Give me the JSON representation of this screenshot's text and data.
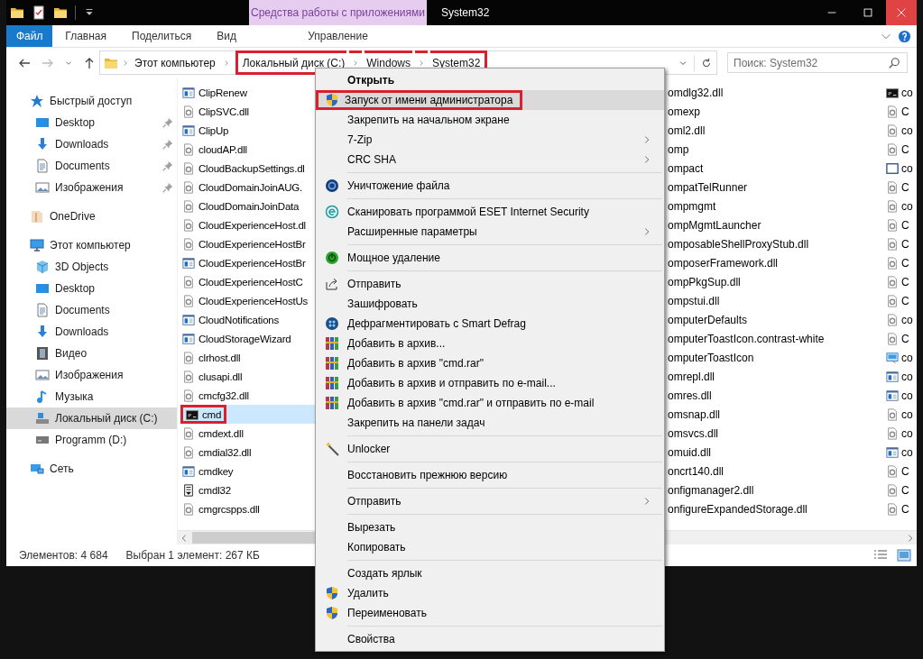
{
  "window": {
    "title": "System32",
    "context_tab": "Средства работы с приложениями"
  },
  "ribbon": {
    "tabs": [
      {
        "label": "Файл",
        "kind": "file",
        "selected": false
      },
      {
        "label": "Главная",
        "kind": "plain",
        "selected": false
      },
      {
        "label": "Поделиться",
        "kind": "plain",
        "selected": false
      },
      {
        "label": "Вид",
        "kind": "plain",
        "selected": false
      },
      {
        "label": "Управление",
        "kind": "context",
        "selected": false
      }
    ]
  },
  "address_bar": {
    "crumbs": [
      {
        "label": "Этот компьютер",
        "highlighted": false
      },
      {
        "label": "Локальный диск (C:)",
        "highlighted": true
      },
      {
        "label": "Windows",
        "highlighted": true
      },
      {
        "label": "System32",
        "highlighted": true
      }
    ]
  },
  "search": {
    "placeholder": "Поиск: System32"
  },
  "navigation": {
    "items": [
      {
        "label": "Быстрый доступ",
        "kind": "star",
        "selected": false,
        "children": [
          {
            "label": "Desktop",
            "kind": "desktop",
            "pinned": true,
            "selected": false
          },
          {
            "label": "Downloads",
            "kind": "download",
            "pinned": true,
            "selected": false
          },
          {
            "label": "Documents",
            "kind": "document",
            "pinned": true,
            "selected": false
          },
          {
            "label": "Изображения",
            "kind": "pictures",
            "pinned": true,
            "selected": false
          }
        ]
      },
      {
        "label": "OneDrive",
        "kind": "cloud_folder",
        "selected": false
      },
      {
        "label": "Этот компьютер",
        "kind": "computer",
        "selected": false,
        "children": [
          {
            "label": "3D Objects",
            "kind": "cube",
            "selected": false
          },
          {
            "label": "Desktop",
            "kind": "desktop",
            "selected": false
          },
          {
            "label": "Documents",
            "kind": "document",
            "selected": false
          },
          {
            "label": "Downloads",
            "kind": "download",
            "selected": false
          },
          {
            "label": "Видео",
            "kind": "video",
            "selected": false
          },
          {
            "label": "Изображения",
            "kind": "pictures",
            "selected": false
          },
          {
            "label": "Музыка",
            "kind": "music",
            "selected": false
          },
          {
            "label": "Локальный диск (C:)",
            "kind": "system_drive",
            "selected": true
          },
          {
            "label": "Programm (D:)",
            "kind": "drive",
            "selected": false
          }
        ]
      },
      {
        "label": "Сеть",
        "kind": "network",
        "selected": false
      }
    ]
  },
  "files": {
    "columns": [
      {
        "items": [
          {
            "name": "ClipRenew",
            "kind": "app",
            "selected": false,
            "highlighted": false
          },
          {
            "name": "ClipSVC.dll",
            "kind": "dll",
            "selected": false,
            "highlighted": false
          },
          {
            "name": "ClipUp",
            "kind": "app",
            "selected": false,
            "highlighted": false
          },
          {
            "name": "cloudAP.dll",
            "kind": "dll",
            "selected": false,
            "highlighted": false
          },
          {
            "name": "CloudBackupSettings.dl",
            "kind": "dll",
            "selected": false,
            "highlighted": false
          },
          {
            "name": "CloudDomainJoinAUG.",
            "kind": "dll",
            "selected": false,
            "highlighted": false
          },
          {
            "name": "CloudDomainJoinData",
            "kind": "dll",
            "selected": false,
            "highlighted": false
          },
          {
            "name": "CloudExperienceHost.dl",
            "kind": "dll",
            "selected": false,
            "highlighted": false
          },
          {
            "name": "CloudExperienceHostBr",
            "kind": "dll",
            "selected": false,
            "highlighted": false
          },
          {
            "name": "CloudExperienceHostBr",
            "kind": "app",
            "selected": false,
            "highlighted": false
          },
          {
            "name": "CloudExperienceHostC",
            "kind": "dll",
            "selected": false,
            "highlighted": false
          },
          {
            "name": "CloudExperienceHostUs",
            "kind": "dll",
            "selected": false,
            "highlighted": false
          },
          {
            "name": "CloudNotifications",
            "kind": "app",
            "selected": false,
            "highlighted": false
          },
          {
            "name": "CloudStorageWizard",
            "kind": "app",
            "selected": false,
            "highlighted": false
          },
          {
            "name": "clrhost.dll",
            "kind": "dll",
            "selected": false,
            "highlighted": false
          },
          {
            "name": "clusapi.dll",
            "kind": "dll",
            "selected": false,
            "highlighted": false
          },
          {
            "name": "cmcfg32.dll",
            "kind": "dll",
            "selected": false,
            "highlighted": false
          },
          {
            "name": "cmd",
            "kind": "console",
            "selected": true,
            "highlighted": true
          },
          {
            "name": "cmdext.dll",
            "kind": "dll",
            "selected": false,
            "highlighted": false
          },
          {
            "name": "cmdial32.dll",
            "kind": "dll",
            "selected": false,
            "highlighted": false
          },
          {
            "name": "cmdkey",
            "kind": "app",
            "selected": false,
            "highlighted": false
          },
          {
            "name": "cmdl32",
            "kind": "script",
            "selected": false,
            "highlighted": false
          },
          {
            "name": "cmgrcspps.dll",
            "kind": "dll",
            "selected": false,
            "highlighted": false
          }
        ]
      },
      {
        "items": [
          {
            "name": "omdlg32.dll",
            "selected": false
          },
          {
            "name": "omexp",
            "selected": false
          },
          {
            "name": "oml2.dll",
            "selected": false
          },
          {
            "name": "omp",
            "selected": false
          },
          {
            "name": "ompact",
            "selected": false
          },
          {
            "name": "ompatTelRunner",
            "selected": false
          },
          {
            "name": "ompmgmt",
            "selected": false
          },
          {
            "name": "ompMgmtLauncher",
            "selected": false
          },
          {
            "name": "omposableShellProxyStub.dll",
            "selected": false
          },
          {
            "name": "omposerFramework.dll",
            "selected": false
          },
          {
            "name": "ompPkgSup.dll",
            "selected": false
          },
          {
            "name": "ompstui.dll",
            "selected": false
          },
          {
            "name": "omputerDefaults",
            "selected": false
          },
          {
            "name": "omputerToastIcon.contrast-white",
            "selected": false
          },
          {
            "name": "omputerToastIcon",
            "selected": false
          },
          {
            "name": "omrepl.dll",
            "selected": false
          },
          {
            "name": "omres.dll",
            "selected": false
          },
          {
            "name": "omsnap.dll",
            "selected": false
          },
          {
            "name": "omsvcs.dll",
            "selected": false
          },
          {
            "name": "omuid.dll",
            "selected": false
          },
          {
            "name": "oncrt140.dll",
            "selected": false
          },
          {
            "name": "onfigmanager2.dll",
            "selected": false
          },
          {
            "name": "onfigureExpandedStorage.dll",
            "selected": false
          }
        ]
      },
      {
        "items": [
          {
            "name": "co",
            "kind": "console",
            "selected": false
          },
          {
            "name": "C",
            "kind": "dll",
            "selected": false
          },
          {
            "name": "co",
            "kind": "dll",
            "selected": false
          },
          {
            "name": "C",
            "kind": "dll",
            "selected": false
          },
          {
            "name": "co",
            "kind": "window",
            "selected": false
          },
          {
            "name": "C",
            "kind": "dll",
            "selected": false
          },
          {
            "name": "co",
            "kind": "dll",
            "selected": false
          },
          {
            "name": "C",
            "kind": "dll",
            "selected": false
          },
          {
            "name": "C",
            "kind": "dll",
            "selected": false
          },
          {
            "name": "C",
            "kind": "dll",
            "selected": false
          },
          {
            "name": "C",
            "kind": "dll",
            "selected": false
          },
          {
            "name": "C",
            "kind": "dll",
            "selected": false
          },
          {
            "name": "co",
            "kind": "dll",
            "selected": false
          },
          {
            "name": "C",
            "kind": "dll",
            "selected": false
          },
          {
            "name": "co",
            "kind": "screen",
            "selected": false
          },
          {
            "name": "co",
            "kind": "app",
            "selected": false
          },
          {
            "name": "co",
            "kind": "app",
            "selected": false
          },
          {
            "name": "co",
            "kind": "dll",
            "selected": false
          },
          {
            "name": "co",
            "kind": "dll",
            "selected": false
          },
          {
            "name": "co",
            "kind": "app",
            "selected": false
          },
          {
            "name": "C",
            "kind": "dll",
            "selected": false
          },
          {
            "name": "C",
            "kind": "dll",
            "selected": false
          },
          {
            "name": "C",
            "kind": "dll",
            "selected": false
          }
        ]
      }
    ]
  },
  "status_bar": {
    "item_count": "Элементов: 4 684",
    "selection": "Выбран 1 элемент: 267 КБ"
  },
  "context_menu": {
    "sections": [
      {
        "items": [
          {
            "label": "Открыть",
            "default": true,
            "selected": false,
            "highlighted": false,
            "submenu": false
          },
          {
            "label": "Запуск от имени администратора",
            "kind": "shield",
            "default": false,
            "selected": true,
            "highlighted": true,
            "submenu": false
          },
          {
            "label": "Закрепить на начальном экране",
            "default": false,
            "selected": false,
            "highlighted": false,
            "submenu": false
          },
          {
            "label": "7-Zip",
            "default": false,
            "selected": false,
            "highlighted": false,
            "submenu": true
          },
          {
            "label": "CRC SHA",
            "default": false,
            "selected": false,
            "highlighted": false,
            "submenu": true
          }
        ]
      },
      {
        "items": [
          {
            "label": "Уничтожение файла",
            "kind": "shred",
            "default": false,
            "selected": false,
            "highlighted": false,
            "submenu": false
          }
        ]
      },
      {
        "items": [
          {
            "label": "Сканировать программой ESET Internet Security",
            "kind": "eset",
            "default": false,
            "selected": false,
            "highlighted": false,
            "submenu": false
          },
          {
            "label": "Расширенные параметры",
            "default": false,
            "selected": false,
            "highlighted": false,
            "submenu": true
          }
        ]
      },
      {
        "items": [
          {
            "label": "Мощное удаление",
            "kind": "power",
            "default": false,
            "selected": false,
            "highlighted": false,
            "submenu": false
          }
        ]
      },
      {
        "items": [
          {
            "label": "Отправить",
            "kind": "share",
            "default": false,
            "selected": false,
            "highlighted": false,
            "submenu": false
          },
          {
            "label": "Зашифровать",
            "default": false,
            "selected": false,
            "highlighted": false,
            "submenu": false
          },
          {
            "label": "Дефрагментировать с Smart Defrag",
            "kind": "defrag",
            "default": false,
            "selected": false,
            "highlighted": false,
            "submenu": false
          },
          {
            "label": "Добавить в архив...",
            "kind": "rar",
            "default": false,
            "selected": false,
            "highlighted": false,
            "submenu": false
          },
          {
            "label": "Добавить в архив \"cmd.rar\"",
            "kind": "rar",
            "default": false,
            "selected": false,
            "highlighted": false,
            "submenu": false
          },
          {
            "label": "Добавить в архив и отправить по e-mail...",
            "kind": "rar",
            "default": false,
            "selected": false,
            "highlighted": false,
            "submenu": false
          },
          {
            "label": "Добавить в архив \"cmd.rar\" и отправить по e-mail",
            "kind": "rar",
            "default": false,
            "selected": false,
            "highlighted": false,
            "submenu": false
          },
          {
            "label": "Закрепить на панели задач",
            "default": false,
            "selected": false,
            "highlighted": false,
            "submenu": false
          }
        ]
      },
      {
        "items": [
          {
            "label": "Unlocker",
            "kind": "wand",
            "default": false,
            "selected": false,
            "highlighted": false,
            "submenu": false
          }
        ]
      },
      {
        "items": [
          {
            "label": "Восстановить прежнюю версию",
            "default": false,
            "selected": false,
            "highlighted": false,
            "submenu": false
          }
        ]
      },
      {
        "items": [
          {
            "label": "Отправить",
            "default": false,
            "selected": false,
            "highlighted": false,
            "submenu": true
          }
        ]
      },
      {
        "items": [
          {
            "label": "Вырезать",
            "default": false,
            "selected": false,
            "highlighted": false,
            "submenu": false
          },
          {
            "label": "Копировать",
            "default": false,
            "selected": false,
            "highlighted": false,
            "submenu": false
          }
        ]
      },
      {
        "items": [
          {
            "label": "Создать ярлык",
            "default": false,
            "selected": false,
            "highlighted": false,
            "submenu": false
          },
          {
            "label": "Удалить",
            "kind": "shield",
            "default": false,
            "selected": false,
            "highlighted": false,
            "submenu": false
          },
          {
            "label": "Переименовать",
            "kind": "shield",
            "default": false,
            "selected": false,
            "highlighted": false,
            "submenu": false
          }
        ]
      },
      {
        "items": [
          {
            "label": "Свойства",
            "default": false,
            "selected": false,
            "highlighted": false,
            "submenu": false
          }
        ]
      }
    ]
  }
}
